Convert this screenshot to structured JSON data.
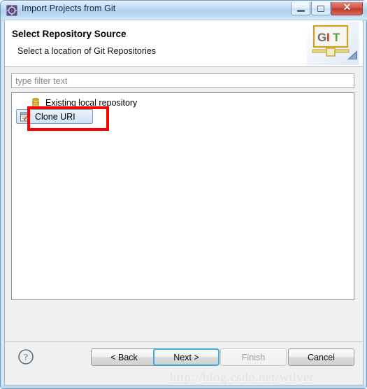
{
  "window": {
    "title": "Import Projects from Git",
    "icon": "git-import-icon",
    "controls": {
      "minimize": "minimize-icon",
      "maximize": "maximize-icon",
      "close": "close-icon",
      "close_glyph": "✕"
    }
  },
  "banner": {
    "title": "Select Repository Source",
    "subtitle": "Select a location of Git Repositories",
    "logo": {
      "name": "git-logo",
      "letters": [
        "G",
        "I",
        "T"
      ],
      "colors": {
        "g": "#6e6e6e",
        "i": "#c0392b",
        "t": "#45a049",
        "border": "#c9a227",
        "plate": "#f5f5f0"
      }
    }
  },
  "filter": {
    "name": "type-filter-text-input",
    "value": "",
    "placeholder": "type filter text"
  },
  "list": {
    "items": [
      {
        "label": "Existing local repository",
        "icon": "repository-cylinder-icon",
        "selected": false
      },
      {
        "label": "Clone URI",
        "icon": "clone-uri-pencil-icon",
        "selected": true
      }
    ]
  },
  "annotation": {
    "name": "red-highlight-rectangle",
    "color": "#ff0000",
    "target": "Clone URI"
  },
  "footer": {
    "help": "help-icon",
    "buttons": [
      {
        "label": "< Back",
        "name": "back-button",
        "state": "enabled"
      },
      {
        "label": "Next >",
        "name": "next-button",
        "state": "focused"
      },
      {
        "label": "Finish",
        "name": "finish-button",
        "state": "disabled"
      },
      {
        "label": "Cancel",
        "name": "cancel-button",
        "state": "enabled"
      }
    ]
  },
  "watermark": {
    "text": "http://blog.csdn.net/wilver"
  }
}
